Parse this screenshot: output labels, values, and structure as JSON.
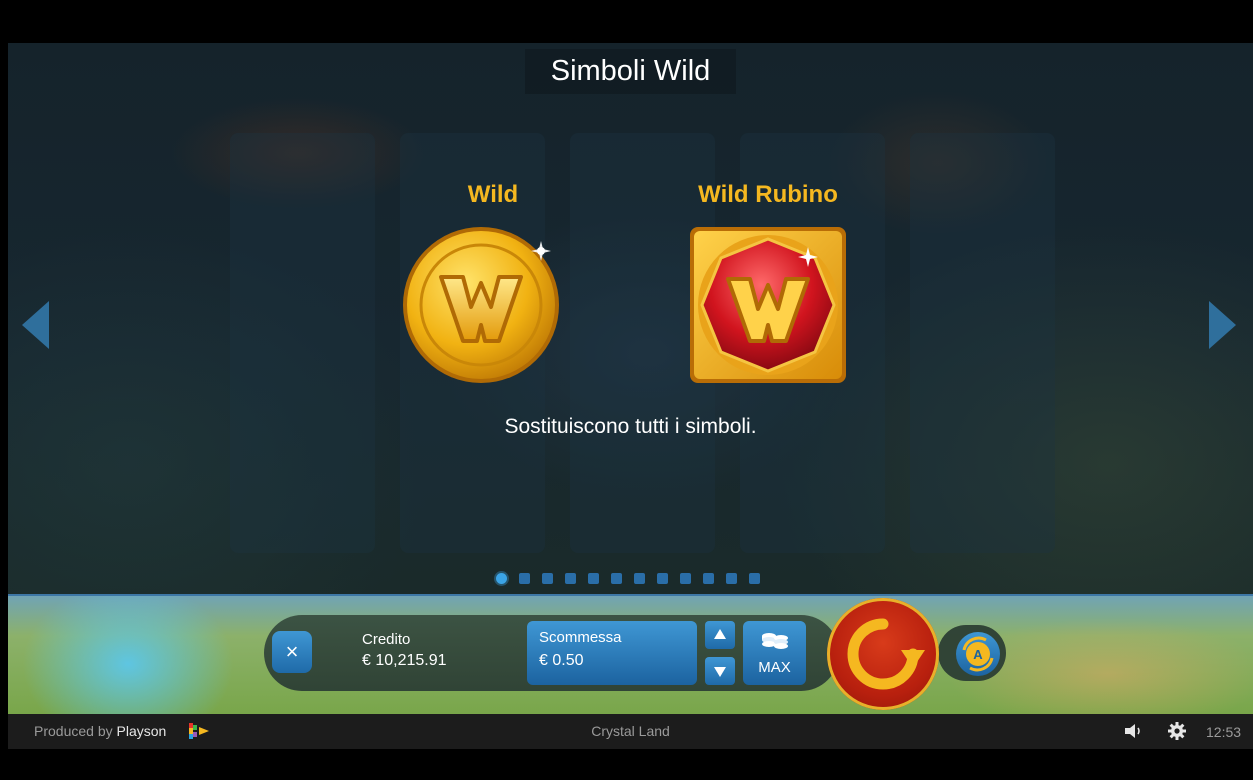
{
  "page": {
    "title": "Simboli Wild",
    "symbols": [
      {
        "label": "Wild",
        "icon": "wild-coin-icon"
      },
      {
        "label": "Wild Rubino",
        "icon": "wild-ruby-icon"
      }
    ],
    "description": "Sostituiscono tutti i simboli.",
    "pagination": {
      "total": 12,
      "current": 1
    }
  },
  "control_bar": {
    "close_label": "×",
    "credit_label": "Credito",
    "credit_value": "€ 10,215.91",
    "bet_label": "Scommessa",
    "bet_value": "€ 0.50",
    "max_label": "MAX"
  },
  "footer": {
    "produced_by": "Produced by",
    "brand": "Playson",
    "game_name": "Crystal Land",
    "time": "12:53"
  },
  "colors": {
    "accent_blue": "#2f6f9c",
    "gold": "#f5b820",
    "spin_red": "#c2290f"
  }
}
